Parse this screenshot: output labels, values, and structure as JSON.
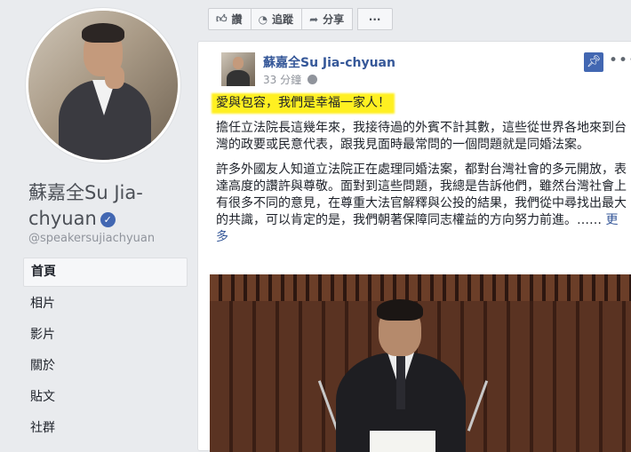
{
  "page": {
    "name": "蘇嘉全Su Jia-chyuan",
    "username": "@speakersujiachyuan"
  },
  "nav": {
    "items": [
      {
        "label": "首頁",
        "active": true
      },
      {
        "label": "相片"
      },
      {
        "label": "影片"
      },
      {
        "label": "關於"
      },
      {
        "label": "貼文"
      },
      {
        "label": "社群"
      }
    ]
  },
  "action_bar": {
    "like_label": "讚",
    "follow_label": "追蹤",
    "share_label": "分享",
    "more_label": "···"
  },
  "post": {
    "author": "蘇嘉全Su Jia-chyuan",
    "time": "33 分鐘",
    "headline": "愛與包容，我們是幸福一家人！",
    "paragraph1": "擔任立法院長這幾年來，我接待過的外賓不計其數，這些從世界各地來到台灣的政要或民意代表，跟我見面時最常問的一個問題就是同婚法案。",
    "paragraph2": "許多外國友人知道立法院正在處理同婚法案，都對台灣社會的多元開放，表達高度的讚許與尊敬。面對到這些問題，我總是告訴他們，雖然台灣社會上有很多不同的意見，在尊重大法官解釋與公投的結果，我們從中尋找出最大的共識，可以肯定的是，我們朝著保障同志權益的方向努力前進。……",
    "see_more": "更多",
    "menu_label": "•••"
  },
  "colors": {
    "link": "#365899",
    "highlight": "#fff021",
    "brand": "#4267b2"
  }
}
